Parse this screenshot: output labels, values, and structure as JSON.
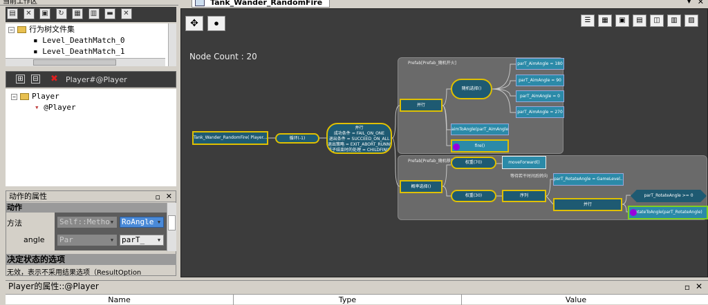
{
  "workspace": {
    "title": "当前工作区",
    "tree_root": "行为树文件集",
    "files": [
      "Level_DeathMatch_0",
      "Level_DeathMatch_1"
    ]
  },
  "player_panel": {
    "header": "Player#@Player",
    "root": "Player",
    "child": "@Player"
  },
  "action_props": {
    "title": "动作的属性",
    "section_action": "动作",
    "row_method": "方法",
    "method_value1": "Self::Metho",
    "method_value2": "RoAngle",
    "row_angle": "angle",
    "angle_value1": "Par",
    "angle_value2": "parT_",
    "section_result": "决定状态的选项",
    "result_desc": "无效，表示不采用结果选项（ResultOption"
  },
  "bottom_panel": {
    "title": "Player的属性::@Player",
    "columns": [
      "Name",
      "Type",
      "Value"
    ]
  },
  "editor": {
    "tab": "Tank_Wander_RandomFire",
    "node_count": "Node Count : 20",
    "nodes": {
      "root": "Tank_Wander_RandomFire( Player...",
      "loop": "循环(-1)",
      "parallel_main": "并行",
      "parallel_main_l1": "成功条件 = FAIL_ON_ONE",
      "parallel_main_l2": "退出条件 = SUCCEED_ON_ALL",
      "parallel_main_l3": "退出策略 = EXIT_ABORT_RUNNINGSIBL",
      "parallel_main_l4": "孩子结束时的处理 = CHILDFINISH_LOOP",
      "group1": "Prefab[Prefab_随机开火]",
      "group2": "Prefab[Prefab_随机移动]",
      "parallel_a": "并行",
      "random_select": "随机选择()",
      "aim1": "parT_AimAngle = 180",
      "aim2": "parT_AimAngle = 90",
      "aim3": "parT_AimAngle = 0",
      "aim4": "parT_AimAngle = 270",
      "aim_to": "aimToAngle(parT_AimAngle)",
      "fire": "fire()",
      "random_select2": "概率选择()",
      "weight70": "权重(70)",
      "move_forward": "moveForward()",
      "weight30": "权重(30)",
      "sequence": "序列",
      "note": "等待若干时间后转向",
      "rotate_assign": "parT_RotateAngle = GameLevel...",
      "parallel_b": "并行",
      "cond": "parT_RotateAngle >= 0",
      "rotate_to": "rotateToAngle(parT_RotateAngle)"
    }
  }
}
